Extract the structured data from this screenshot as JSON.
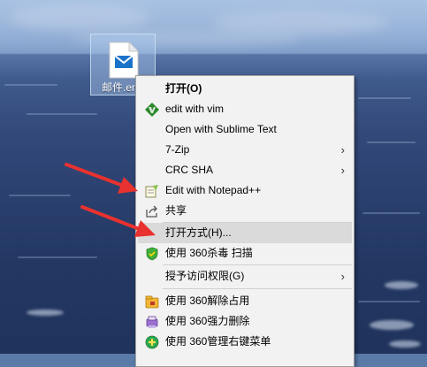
{
  "desktop": {
    "file_label": "邮件.eml"
  },
  "context_menu": {
    "items": [
      {
        "label": "打开(O)",
        "bold": true,
        "icon": "none"
      },
      {
        "label": "edit with vim",
        "icon": "vim-icon"
      },
      {
        "label": "Open with Sublime Text",
        "icon": "none"
      },
      {
        "label": "7-Zip",
        "icon": "none",
        "submenu": true
      },
      {
        "label": "CRC SHA",
        "icon": "none",
        "submenu": true
      },
      {
        "label": "Edit with Notepad++",
        "icon": "notepadpp-icon"
      },
      {
        "label": "共享",
        "icon": "share-icon"
      },
      {
        "label": "打开方式(H)...",
        "icon": "none",
        "highlighted": true
      },
      {
        "label": "使用 360杀毒 扫描",
        "icon": "shield-360-icon"
      },
      {
        "label": "授予访问权限(G)",
        "icon": "none",
        "submenu": true
      },
      {
        "label": "使用 360解除占用",
        "icon": "unlock-360-icon"
      },
      {
        "label": "使用 360强力删除",
        "icon": "delete-360-icon"
      },
      {
        "label": "使用 360管理右键菜单",
        "icon": "manage-360-icon"
      }
    ],
    "submenu_arrow": "›"
  },
  "annotations": {
    "color": "#e8322f",
    "count": 2
  }
}
